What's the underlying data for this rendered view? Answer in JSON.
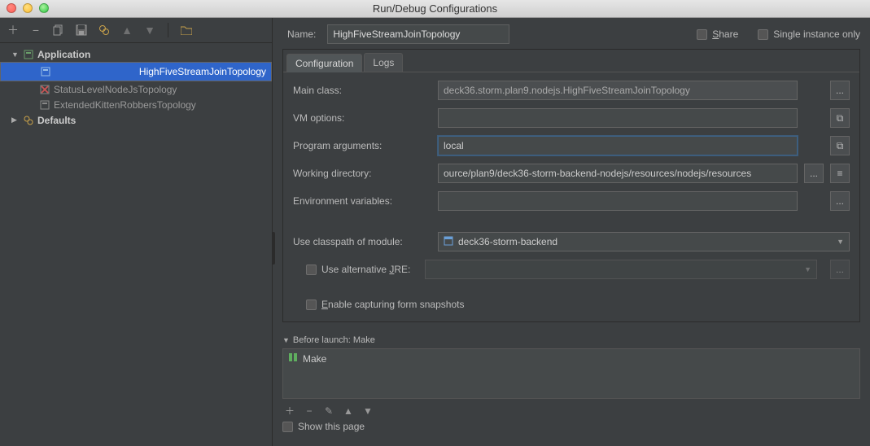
{
  "window": {
    "title": "Run/Debug Configurations"
  },
  "sidebar": {
    "items": [
      {
        "label": "Application",
        "kind": "group"
      },
      {
        "label": "HighFiveStreamJoinTopology",
        "kind": "runcfg",
        "selected": true
      },
      {
        "label": "StatusLevelNodeJsTopology",
        "kind": "runcfg-err"
      },
      {
        "label": "ExtendedKittenRobbersTopology",
        "kind": "runcfg"
      },
      {
        "label": "Defaults",
        "kind": "group"
      }
    ]
  },
  "header": {
    "name_label": "Name:",
    "name_value": "HighFiveStreamJoinTopology",
    "share_label": "Share",
    "single_label": "Single instance only"
  },
  "tabs": {
    "configuration": "Configuration",
    "logs": "Logs"
  },
  "form": {
    "main_class_label": "Main class:",
    "main_class_value": "deck36.storm.plan9.nodejs.HighFiveStreamJoinTopology",
    "vm_options_label": "VM options:",
    "vm_options_value": "",
    "program_args_label": "Program arguments:",
    "program_args_value": "local",
    "working_dir_label": "Working directory:",
    "working_dir_value": "ource/plan9/deck36-storm-backend-nodejs/resources/nodejs/resources",
    "env_vars_label": "Environment variables:",
    "env_vars_value": "",
    "classpath_label": "Use classpath of module:",
    "classpath_value": "deck36-storm-backend",
    "alt_jre_label": "Use alternative JRE:",
    "alt_jre_value": "",
    "snapshots_label": "Enable capturing form snapshots",
    "browse_glyph": "...",
    "expand_glyph": "⧉",
    "list_glyph": "≡"
  },
  "before": {
    "header": "Before launch: Make",
    "item": "Make",
    "show_page_label": "Show this page"
  }
}
